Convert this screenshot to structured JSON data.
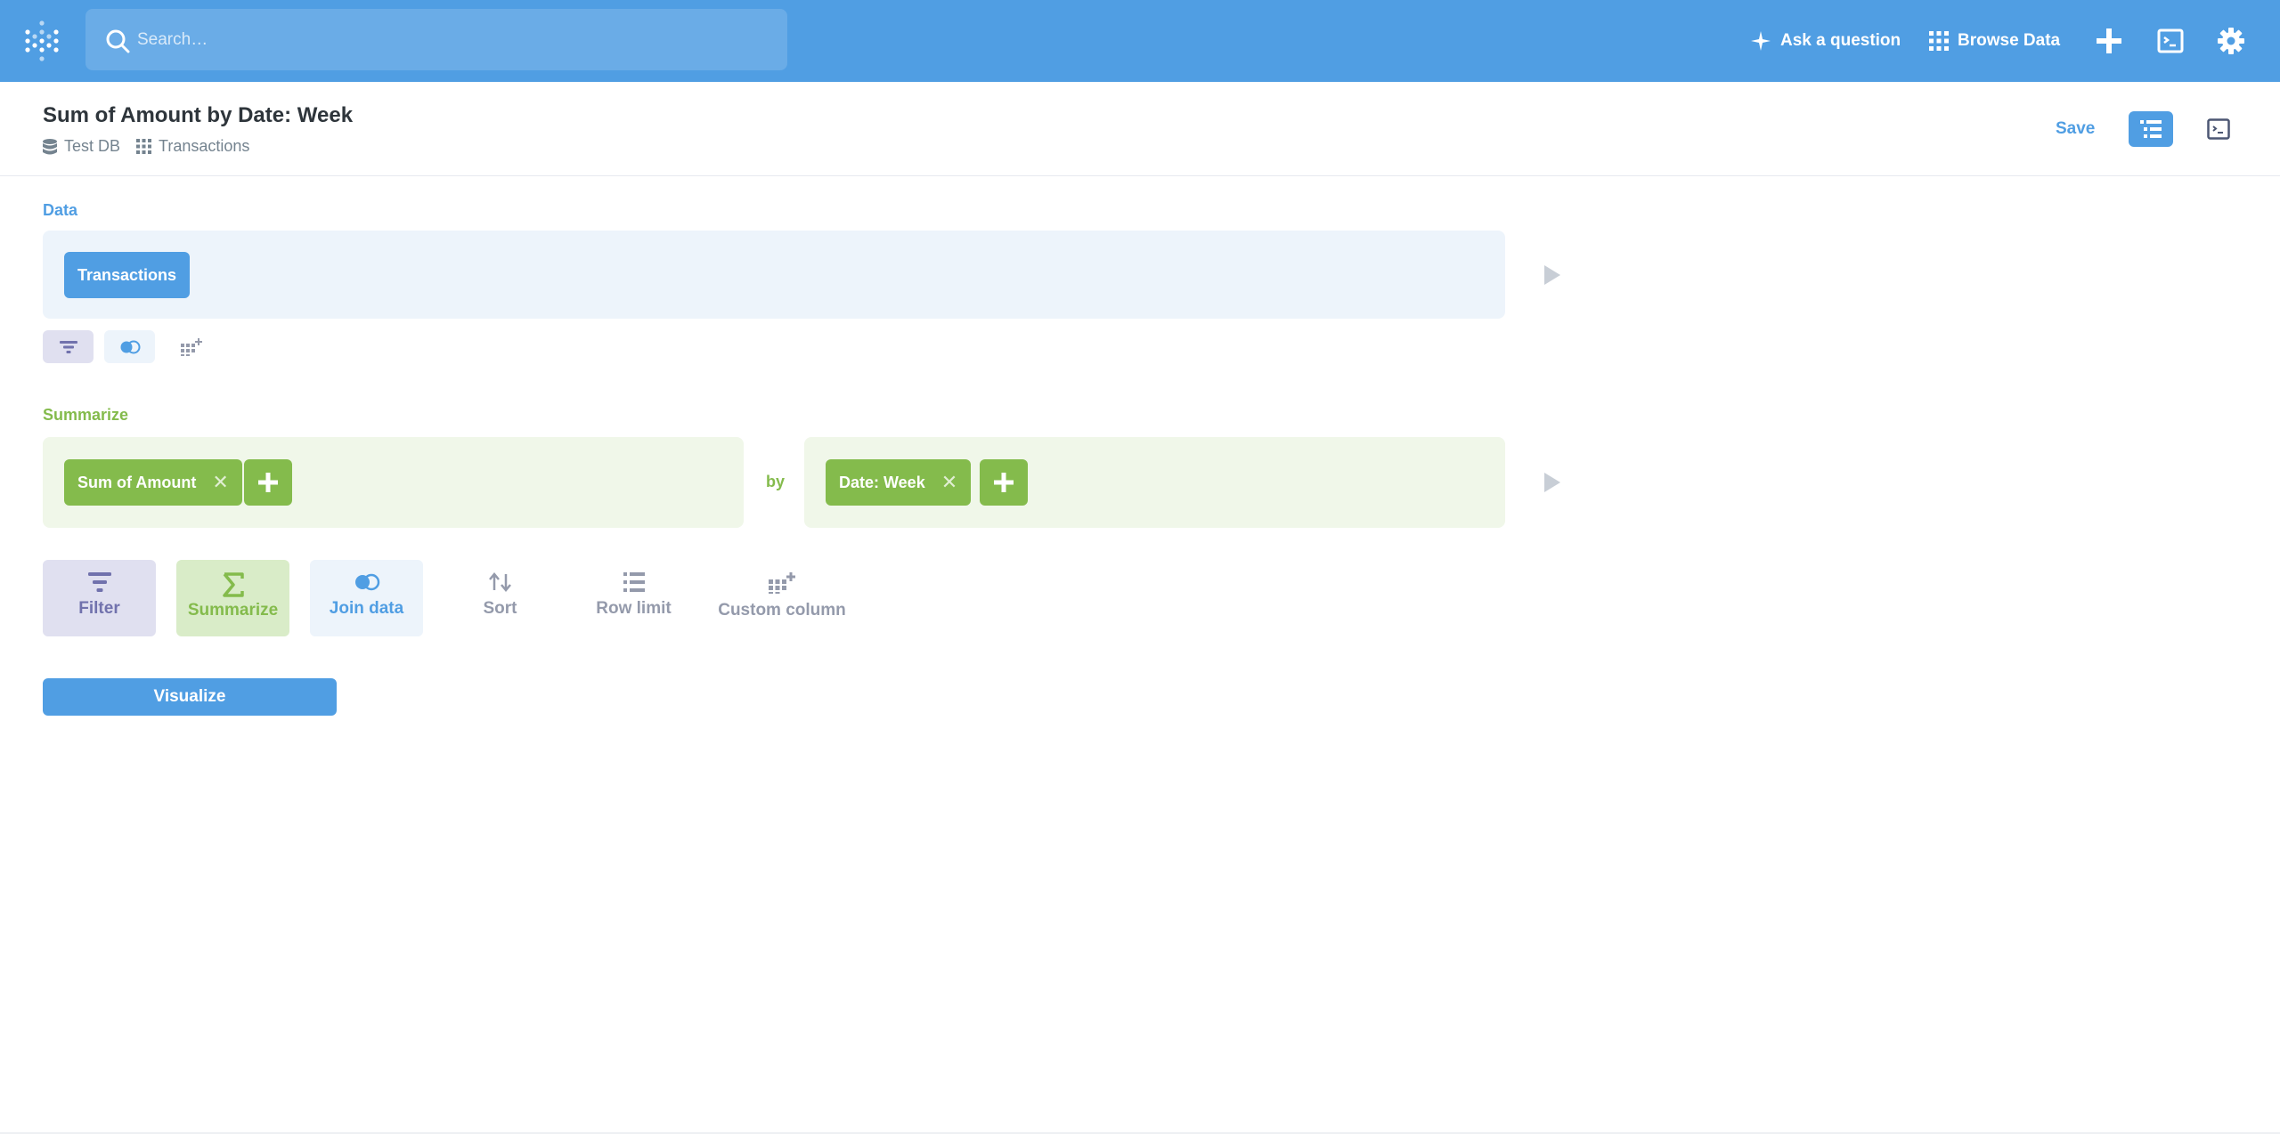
{
  "nav": {
    "search_placeholder": "Search…",
    "ask_question": "Ask a question",
    "browse_data": "Browse Data",
    "icons": [
      "metabase-logo-icon",
      "search-icon",
      "sparkle-icon",
      "grid-icon",
      "plus-icon",
      "sql-editor-icon",
      "gear-icon"
    ]
  },
  "header": {
    "title": "Sum of Amount by Date: Week",
    "database": "Test DB",
    "table": "Transactions",
    "save_label": "Save"
  },
  "data_step": {
    "label": "Data",
    "source": "Transactions"
  },
  "summarize_step": {
    "label": "Summarize",
    "metric": "Sum of Amount",
    "by_label": "by",
    "breakout": "Date: Week"
  },
  "actions": {
    "filter": "Filter",
    "summarize": "Summarize",
    "join": "Join data",
    "sort": "Sort",
    "row_limit": "Row limit",
    "custom_column": "Custom column"
  },
  "visualize_label": "Visualize",
  "colors": {
    "brand": "#509ee3",
    "summarize": "#84bb4c",
    "filter": "#7172ad"
  }
}
